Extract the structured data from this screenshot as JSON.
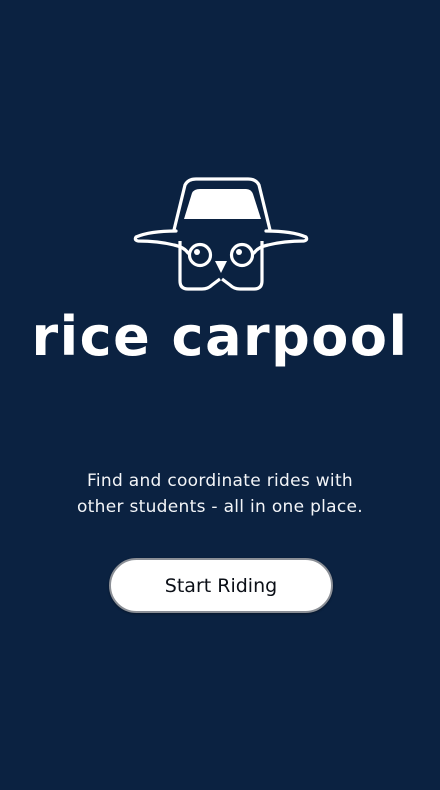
{
  "brand": {
    "logo_icon": "owl-car-logo-icon",
    "wordmark": "rice carpool"
  },
  "tagline": {
    "line1": "Find and coordinate rides with",
    "line2": "other students - all in one place."
  },
  "actions": {
    "start_label": "Start Riding"
  },
  "colors": {
    "background": "#0b2241",
    "foreground": "#ffffff",
    "button_background": "#ffffff",
    "button_text": "#0b0f17"
  }
}
